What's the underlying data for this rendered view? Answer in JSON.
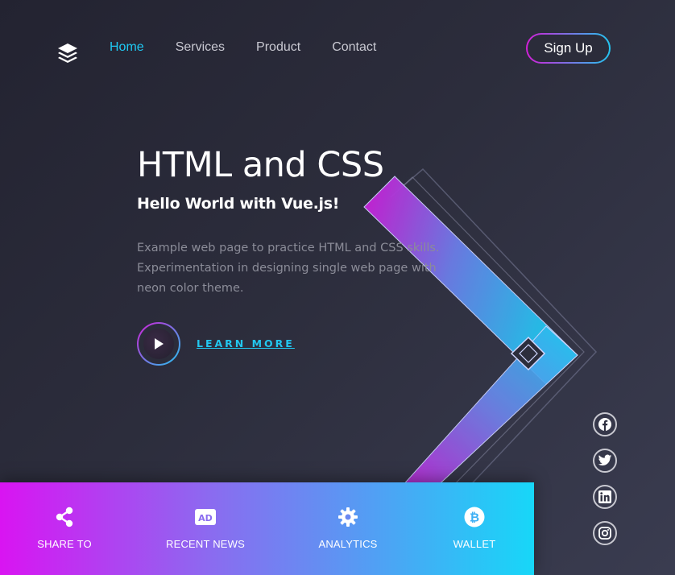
{
  "nav": {
    "logo_icon": "layers-icon",
    "items": [
      {
        "label": "Home",
        "active": true
      },
      {
        "label": "Services",
        "active": false
      },
      {
        "label": "Product",
        "active": false
      },
      {
        "label": "Contact",
        "active": false
      }
    ],
    "signup_label": "Sign Up"
  },
  "hero": {
    "title": "HTML and CSS",
    "subtitle": "Hello World with Vue.js!",
    "description": "Example web page to practice HTML and CSS skills. Experimentation in designing single web page with neon color theme.",
    "play_icon": "play-icon",
    "cta_label": "LEARN MORE"
  },
  "social": [
    {
      "icon": "facebook-icon"
    },
    {
      "icon": "twitter-icon"
    },
    {
      "icon": "linkedin-icon"
    },
    {
      "icon": "instagram-icon"
    }
  ],
  "bottom_bar": {
    "items": [
      {
        "icon": "share-icon",
        "label": "SHARE TO"
      },
      {
        "icon": "ad-icon",
        "label": "RECENT NEWS",
        "icon_text": "AD"
      },
      {
        "icon": "gear-icon",
        "label": "ANALYTICS"
      },
      {
        "icon": "bitcoin-icon",
        "label": "WALLET"
      }
    ]
  },
  "colors": {
    "accent_cyan": "#1fc9f3",
    "accent_magenta": "#d21fd7",
    "background": "#2c2d3c"
  }
}
